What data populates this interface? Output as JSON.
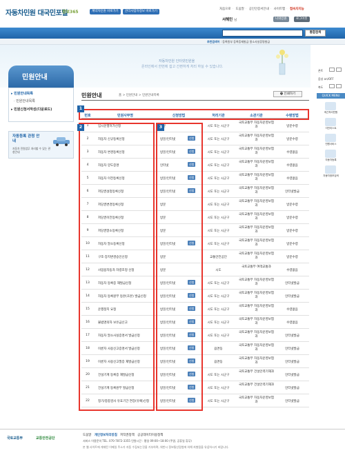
{
  "header": {
    "logo": "자동차민원 대국민포털",
    "logo_sub": "정보365",
    "pill1": "계약자민원 바로가기",
    "pill2": "관리사업자정보 바로가기",
    "util": [
      "처음으로",
      "도움말",
      "공인인증서안내",
      "사이트맵"
    ],
    "util_hi": "접속자지능",
    "user_name": "서해민",
    "user_suffix": "님",
    "myinfo": "나의민원",
    "logout": "로그아웃"
  },
  "gnb": [
    "민원안내",
    "민원신청",
    "민원신청결과",
    "토탈이력조회",
    "알림마당",
    "정보마당"
  ],
  "search": {
    "placeholder": "",
    "button": "통합검색"
  },
  "keywords": {
    "label": "추천검색어",
    "items": "등록원부  등록증재발급  말소사실증명발급"
  },
  "banner": {
    "line1": "자동차민원 인터넷민원을",
    "line2": "온라인에서 한번에 쉽고 간편하게 처리 하실 수 있습니다."
  },
  "side": {
    "title": "민원안내",
    "items": [
      "민원안내목록",
      "민원안내목록",
      "민원신청서작성(다운로드)"
    ],
    "promo_title": "자동등록 관청 안내",
    "promo_desc": "자동차 민원업무 처리할 수 있는 관청안내"
  },
  "right": {
    "font_label": "폰트",
    "font_on": "on",
    "font_off": "OFF",
    "zoom_label": "축도",
    "quick": "QUICK MENU",
    "items": [
      "최근처리민원",
      "이전리스트",
      "민원서비스",
      "자동차등록",
      "자동차정보검색"
    ]
  },
  "page": {
    "title": "민원안내",
    "breadcrumb": "홈  >  민원안내  >  민원안내목록",
    "print": "인쇄하기"
  },
  "table": {
    "headers": [
      "번호",
      "민원사무명",
      "신청방법",
      "처리기관",
      "소관기관",
      "수령방법"
    ],
    "tag": "신청",
    "rows": [
      {
        "no": "1",
        "name": "임시운행허가신청",
        "method": "방문",
        "tag": false,
        "org": "시도 또는 시군구",
        "dept": "국토교통부 자동차운영보험과",
        "recv": "방문수령"
      },
      {
        "no": "2",
        "name": "자동차 신규등록신청",
        "method": "방문/인터넷",
        "tag": true,
        "org": "시도 또는 시군구",
        "dept": "국토교통부 자동차운영보험과",
        "recv": "방문수령"
      },
      {
        "no": "3",
        "name": "자동차 변경등록신청",
        "method": "방문/인터넷",
        "tag": true,
        "org": "시도 또는 시군구",
        "dept": "국토교통부 자동차운영보험과",
        "recv": "수령없음"
      },
      {
        "no": "4",
        "name": "자동차 양도증명",
        "method": "인터넷",
        "tag": true,
        "org": "시도 또는 시군구",
        "dept": "국토교통부 자동차운영보험과",
        "recv": "수령없음"
      },
      {
        "no": "5",
        "name": "자동차 이전등록신청",
        "method": "방문/인터넷",
        "tag": true,
        "org": "시도 또는 시군구",
        "dept": "국토교통부 자동차운영보험과",
        "recv": "수령없음"
      },
      {
        "no": "6",
        "name": "저당권설정등록신청",
        "method": "방문/인터넷",
        "tag": true,
        "org": "시도 또는 시군구",
        "dept": "국토교통부 자동차운영보험과",
        "recv": "인터넷발급"
      },
      {
        "no": "7",
        "name": "저당권변경등록신청",
        "method": "방문",
        "tag": false,
        "org": "시도 또는 시군구",
        "dept": "국토교통부 자동차운영보험과",
        "recv": "방문수령"
      },
      {
        "no": "8",
        "name": "저당권이전등록신청",
        "method": "방문",
        "tag": false,
        "org": "시도 또는 시군구",
        "dept": "국토교통부 자동차운영보험과",
        "recv": "방문수령"
      },
      {
        "no": "9",
        "name": "저당권말소등록신청",
        "method": "방문",
        "tag": false,
        "org": "시도 또는 시군구",
        "dept": "국토교통부 자동차운영보험과",
        "recv": "방문수령"
      },
      {
        "no": "10",
        "name": "자동차 말소등록신청",
        "method": "방문/인터넷",
        "tag": true,
        "org": "시도 또는 시군구",
        "dept": "국토교통부 자동차운영보험과",
        "recv": "방문수령"
      },
      {
        "no": "11",
        "name": "구조·장치변경승인신청",
        "method": "방문",
        "tag": false,
        "org": "교통안전공단",
        "dept": "국토교통부 자동차운영보험과",
        "recv": "방문수령"
      },
      {
        "no": "12",
        "name": "사업용자동차 차령조정 신청",
        "method": "방문",
        "tag": false,
        "org": "시도",
        "dept": "국토교통부 여객교통과",
        "recv": "수령없음"
      },
      {
        "no": "13",
        "name": "자동차 등록증 재발급신청",
        "method": "방문/인터넷",
        "tag": true,
        "org": "시도 또는 시군구",
        "dept": "국토교통부 자동차운영보험과",
        "recv": "인터넷발급"
      },
      {
        "no": "14",
        "name": "자동차 등록원부 등본(초본) 발급신청",
        "method": "방문/인터넷",
        "tag": true,
        "org": "시도 또는 시군구",
        "dept": "국토교통부 자동차운영보험과",
        "recv": "인터넷발급"
      },
      {
        "no": "15",
        "name": "운행정지 요청",
        "method": "방문/인터넷",
        "tag": true,
        "org": "시도 또는 시군구",
        "dept": "국토교통부 자동차운영보험과",
        "recv": "수령없음"
      },
      {
        "no": "16",
        "name": "불법명의자 보유금신고",
        "method": "방문/인터넷",
        "tag": true,
        "org": "시도 또는 시군구",
        "dept": "국토교통부 자동차운영보험과",
        "recv": "수령없음"
      },
      {
        "no": "17",
        "name": "자동차 말소사실증명서 발급신청",
        "method": "방문/인터넷",
        "tag": true,
        "org": "시도 또는 시군구",
        "dept": "국토교통부 자동차운영보험과",
        "recv": "인터넷발급"
      },
      {
        "no": "18",
        "name": "이륜자 사용신고증명서 발급신청",
        "method": "방문/인터넷",
        "tag": true,
        "org": "읍면동",
        "dept": "국토교통부 자동차운영보험과",
        "recv": "인터넷발급"
      },
      {
        "no": "19",
        "name": "이륜자 사용신고필증 재발급신청",
        "method": "방문/인터넷",
        "tag": true,
        "org": "읍면동",
        "dept": "국토교통부 자동차운영보험과",
        "recv": "인터넷발급"
      },
      {
        "no": "20",
        "name": "건설기계 등록증 재발급신청",
        "method": "방문/인터넷",
        "tag": true,
        "org": "시도 또는 시군구",
        "dept": "국토교통부 건설인력기재과",
        "recv": "인터넷발급"
      },
      {
        "no": "21",
        "name": "건설기계 등록원부 발급신청",
        "method": "방문/인터넷",
        "tag": true,
        "org": "시도 또는 시군구",
        "dept": "국토교통부 건설인력기재과",
        "recv": "인터넷발급"
      },
      {
        "no": "22",
        "name": "정기/종합검사 유효기간 연장(유예)신청",
        "method": "방문/인터넷",
        "tag": true,
        "org": "시도 또는 시군구",
        "dept": "국토교통부 자동차운영보험과",
        "recv": "인터넷발급"
      }
    ]
  },
  "badges": [
    "1",
    "2",
    "3"
  ],
  "footer": {
    "logo1": "국토교통부",
    "logo2": "교통안전공단",
    "links": [
      "도움말",
      "개인정보처리방침",
      "저작권정책",
      "공공데이터이용정책"
    ],
    "addr": "서비스 이용문의  TEL. 070-7872-3355   민원시간 : 평일 09:00~18:00 (주말, 공휴일 휴무)",
    "copy": "본 웹 사이트에 게재된 이메일 주소가 자동 수집되는것을 거부하며, 위반시 정보통신망법에 의해 처벌됨을 유념하시기 바랍니다."
  }
}
